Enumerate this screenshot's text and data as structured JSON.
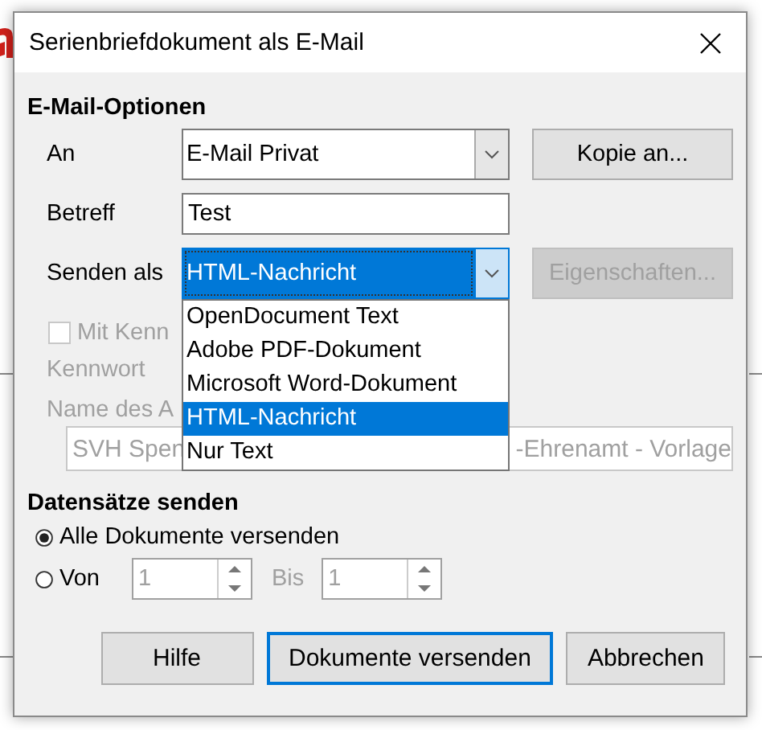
{
  "dialog": {
    "title": "Serienbriefdokument als E-Mail",
    "email_options": {
      "heading": "E-Mail-Optionen",
      "to": {
        "label": "An",
        "value": "E-Mail Privat",
        "button": {
          "label": "Kopie an...",
          "disabled": false
        }
      },
      "subject": {
        "label": "Betreff",
        "value": "Test"
      },
      "send_as": {
        "label": "Senden als",
        "value": "HTML-Nachricht",
        "expanded": true,
        "options": [
          {
            "label": "OpenDocument Text",
            "selected": false
          },
          {
            "label": "Adobe PDF-Dokument",
            "selected": false
          },
          {
            "label": "Microsoft Word-Dokument",
            "selected": false
          },
          {
            "label": "HTML-Nachricht",
            "selected": true
          },
          {
            "label": "Nur Text",
            "selected": false
          }
        ],
        "button": {
          "label": "Eigenschaften...",
          "disabled": true
        }
      },
      "password_checkbox": {
        "label": "Mit Kenn",
        "checked": false,
        "disabled": true
      },
      "password_label": {
        "label": "Kennwort",
        "disabled": true
      },
      "attachment_name": {
        "label": "Name des A",
        "disabled": true,
        "value_start": "SVH Spen",
        "value_end": "-Ehrenamt - Vorlage"
      }
    },
    "records": {
      "heading": "Datensätze senden",
      "options": [
        {
          "label": "Alle Dokumente versenden",
          "selected": true
        },
        {
          "label": "Von",
          "selected": false
        }
      ],
      "from": {
        "value": "1",
        "disabled": true
      },
      "to_label": {
        "label": "Bis",
        "disabled": true
      },
      "to": {
        "value": "1",
        "disabled": true
      }
    },
    "buttons": [
      {
        "label": "Hilfe",
        "default": false
      },
      {
        "label": "Dokumente versenden",
        "default": true
      },
      {
        "label": "Abbrechen",
        "default": false
      }
    ]
  }
}
